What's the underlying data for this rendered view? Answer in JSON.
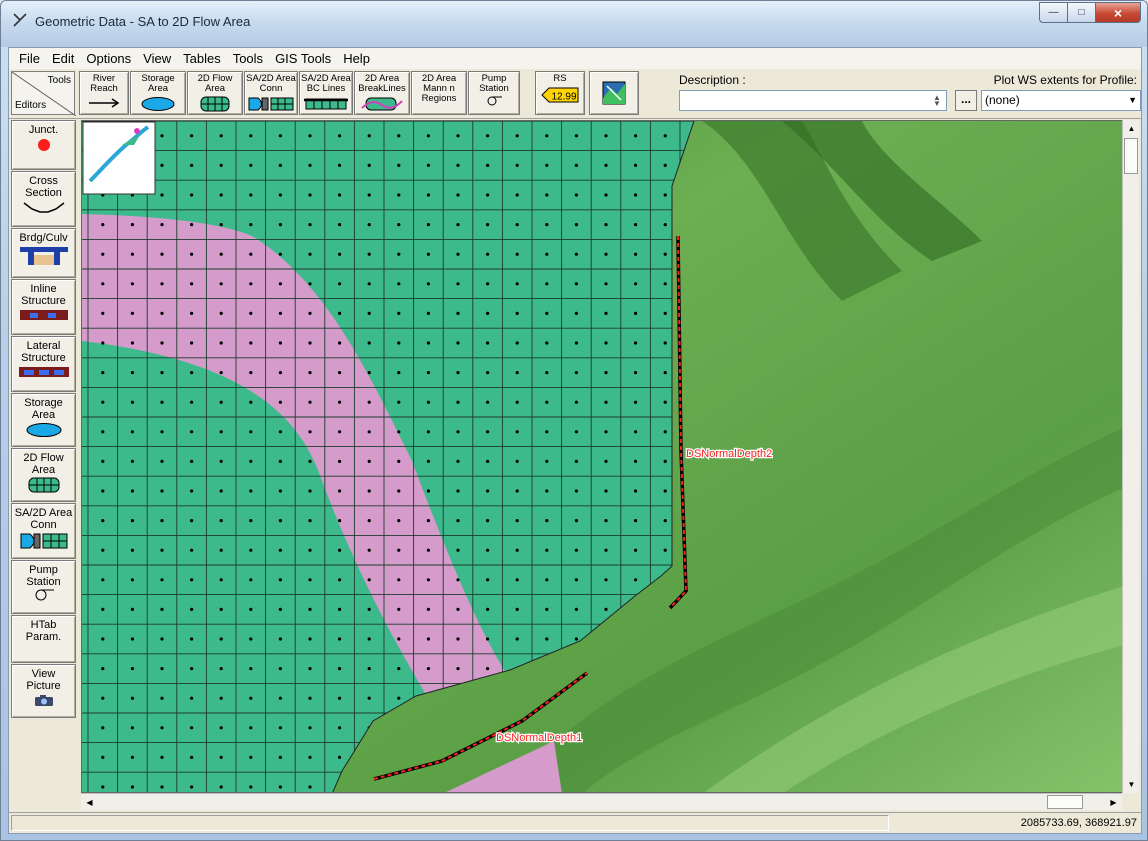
{
  "window": {
    "title": "Geometric Data - SA to 2D Flow Area"
  },
  "menu": [
    "File",
    "Edit",
    "Options",
    "View",
    "Tables",
    "Tools",
    "GIS Tools",
    "Help"
  ],
  "menu_underline": [
    0,
    0,
    0,
    0,
    0,
    0,
    0,
    0
  ],
  "toolbar": {
    "corner_top": "Tools",
    "corner_bottom": "Editors",
    "buttons": [
      "River\nReach",
      "Storage\nArea",
      "2D Flow\nArea",
      "SA/2D Area\nConn",
      "SA/2D Area\nBC Lines",
      "2D Area\nBreakLines",
      "2D Area\nMann n\nRegions",
      "Pump\nStation",
      "RS"
    ],
    "rs_value": "12.99",
    "description_label": "Description :",
    "description_value": "",
    "more_button": "...",
    "plot_label": "Plot WS extents for Profile:",
    "plot_value": "(none)"
  },
  "editors": [
    "Junct.",
    "Cross\nSection",
    "Brdg/Culv",
    "Inline\nStructure",
    "Lateral\nStructure",
    "Storage\nArea",
    "2D Flow\nArea",
    "SA/2D Area\nConn",
    "Pump\nStation",
    "HTab\nParam.",
    "View\nPicture"
  ],
  "map": {
    "bc_lines": [
      "DSNormalDepth2",
      "DSNormalDepth1"
    ],
    "colors": {
      "flow_area": "#3dba8c",
      "mann_region": "#d49bcb",
      "bc_line": "#ff2020",
      "terrain": "#5da34a"
    }
  },
  "status": {
    "coords": "2085733.69, 368921.97"
  }
}
